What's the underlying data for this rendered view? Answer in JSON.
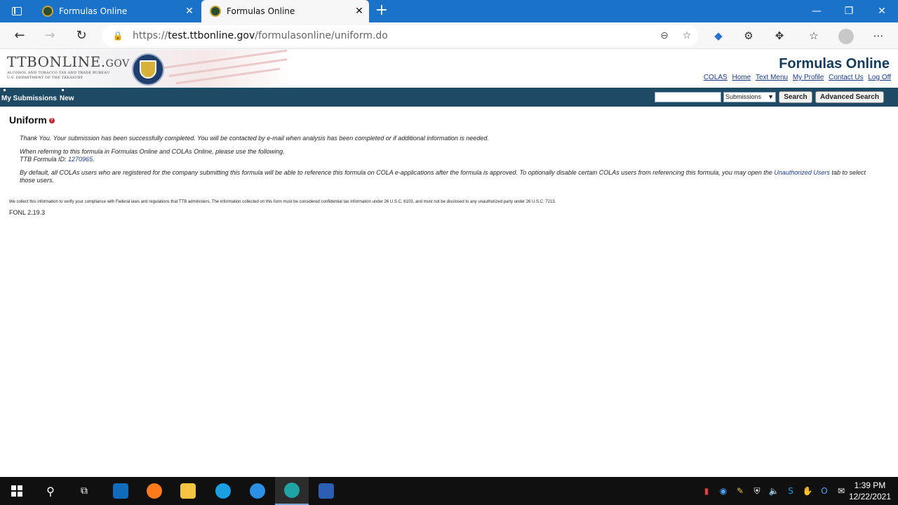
{
  "browser": {
    "tabs": [
      {
        "label": "Formulas Online",
        "active": false
      },
      {
        "label": "Formulas Online",
        "active": true
      }
    ],
    "url_scheme": "https://",
    "url_host": "test.ttbonline.gov",
    "url_path": "/formulasonline/uniform.do"
  },
  "site": {
    "logo_main": "TTBONLINE.",
    "logo_gov": "GOV",
    "logo_line1": "ALCOHOL AND TOBACCO TAX AND TRADE BUREAU",
    "logo_line2": "U.S. DEPARTMENT OF THE TREASURY",
    "app_title": "Formulas Online",
    "links": [
      "COLAS",
      "Home",
      "Text Menu",
      "My Profile",
      "Contact Us",
      "Log Off"
    ]
  },
  "nav": {
    "my_submissions": "My Submissions",
    "new": "New",
    "search_value": "",
    "select_value": "Submissions",
    "search_button": "Search",
    "advanced_search_button": "Advanced Search"
  },
  "content": {
    "title": "Uniform",
    "help_glyph": "?",
    "thank_you": "Thank You. Your submission has been successfully completed. You will be contacted by e-mail when analysis has been completed or if additional information is needed.",
    "referring": "When referring to this formula in Formulas Online and COLAs Online, please use the following.",
    "formula_id_label": "TTB Formula ID:",
    "formula_id": "1270965",
    "default_text": "By default, all COLAs users who are registered for the company submitting this formula will be able to reference this formula on COLA e-applications after the formula is approved. To optionally disable certain COLAs users from referencing this formula, you may open the",
    "unauthorized_link": "Unauthorized Users",
    "default_tail": "tab to select those users.",
    "disclaimer": "We collect this information to verify your compliance with Federal laws and regulations that TTB administers. The information collected on this form must be considered confidential tax information under 26 U.S.C. 6103, and must not be disclosed to any unauthorized party under 26 U.S.C. 7213.",
    "version": "FONL 2.19.3"
  },
  "taskbar": {
    "time": "1:39 PM",
    "date": "12/22/2021"
  },
  "colors": {
    "titlebar": "#1a73c8",
    "navbar": "#1f4a66",
    "app_title": "#143a5c",
    "link": "#1a3a8a"
  }
}
